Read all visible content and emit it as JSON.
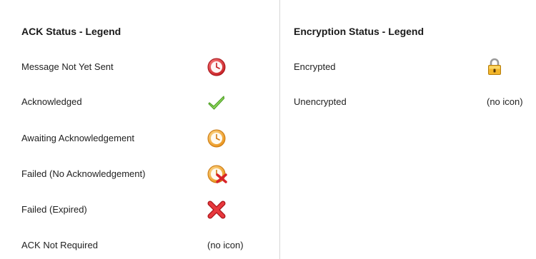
{
  "ack_legend": {
    "title": "ACK Status - Legend",
    "items": [
      {
        "label": "Message Not Yet Sent",
        "icon": "red-clock-icon"
      },
      {
        "label": "Acknowledged",
        "icon": "green-check-icon"
      },
      {
        "label": "Awaiting Acknowledgement",
        "icon": "orange-clock-icon"
      },
      {
        "label": "Failed (No Acknowledgement)",
        "icon": "clock-with-red-x-icon"
      },
      {
        "label": "Failed (Expired)",
        "icon": "red-x-icon"
      },
      {
        "label": "ACK Not Required",
        "icon_text": "(no icon)"
      }
    ]
  },
  "encryption_legend": {
    "title": "Encryption Status - Legend",
    "items": [
      {
        "label": "Encrypted",
        "icon": "padlock-icon"
      },
      {
        "label": "Unencrypted",
        "icon_text": "(no icon)"
      }
    ]
  },
  "colors": {
    "red_clock": "#d9262b",
    "orange_clock": "#f2a22a",
    "check_green": "#5fb52f",
    "x_red": "#d8232a",
    "padlock_gold": "#e9a81d",
    "divider": "#d6d6d6"
  }
}
